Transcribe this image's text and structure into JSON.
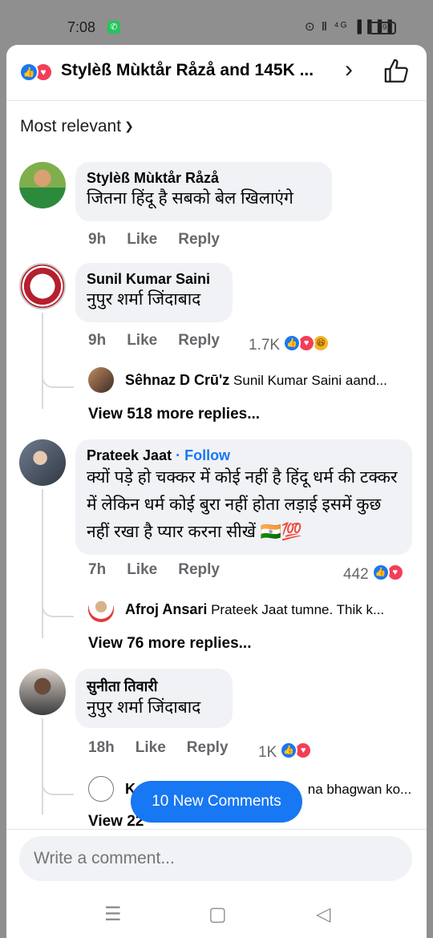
{
  "status": {
    "time": "7:08",
    "indicators": "⊙ Ⅱ ⁴ᴳ ▐▐▐▐",
    "battery": "59"
  },
  "header": {
    "reactors": "Stylèß Mùktår Råzå and 145K ...",
    "chevron_icon": "chevron-right-icon",
    "like_icon": "thumbs-up-outline-icon"
  },
  "sort": {
    "label": "Most relevant"
  },
  "comments": [
    {
      "author": "Stylèß Mùktår Råzå",
      "text": "जितना हिंदू है सबको बेल खिलाएंगे",
      "age": "9h",
      "like": "Like",
      "reply": "Reply"
    },
    {
      "author": "Sunil Kumar Saini",
      "text": "नुपुर शर्मा जिंदाबाद",
      "age": "9h",
      "like": "Like",
      "reply": "Reply",
      "reaction_count": "1.7K",
      "reply_preview": {
        "author": "Sêhnaz D Crū'z",
        "text": "Sunil Kumar Saini aand..."
      },
      "view_more": "View 518 more replies..."
    },
    {
      "author": "Prateek Jaat",
      "follow": " · Follow",
      "text": "क्यों पड़े हो चक्कर में कोई नहीं है हिंदू धर्म की टक्कर में लेकिन धर्म कोई बुरा नहीं होता लड़ाई इसमें कुछ नहीं रखा है प्यार करना सीखें 🇮🇳💯",
      "age": "7h",
      "like": "Like",
      "reply": "Reply",
      "reaction_count": "442",
      "reply_preview": {
        "author": "Afroj Ansari",
        "text": "Prateek Jaat tumne. Thik k..."
      },
      "view_more": "View 76 more replies..."
    },
    {
      "author": "सुनीता तिवारी",
      "text": "नुपुर शर्मा जिंदाबाद",
      "age": "18h",
      "like": "Like",
      "reply": "Reply",
      "reaction_count": "1K",
      "reply_preview": {
        "author": "K",
        "text": "na bhagwan ko..."
      },
      "view_more": "View 22"
    }
  ],
  "new_comments_button": "10 New Comments",
  "composer": {
    "placeholder": "Write a comment..."
  },
  "nav": {
    "menu": "☰",
    "home": "▢",
    "back": "◁"
  },
  "colors": {
    "accent": "#1877f2",
    "love": "#f33e58",
    "haha": "#f7b125",
    "bubble": "#f0f2f5"
  }
}
